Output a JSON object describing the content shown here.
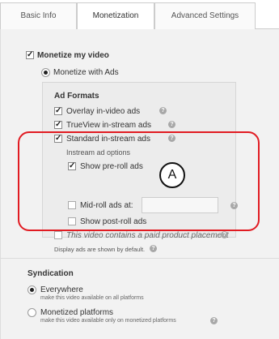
{
  "tabs": [
    {
      "label": "Basic Info"
    },
    {
      "label": "Monetization"
    },
    {
      "label": "Advanced Settings"
    }
  ],
  "monetize": {
    "label": "Monetize my video",
    "checked": true
  },
  "monetize_with_ads": {
    "label": "Monetize with Ads",
    "selected": true
  },
  "ad_formats": {
    "title": "Ad Formats",
    "overlay": {
      "label": "Overlay in-video ads",
      "checked": true
    },
    "trueview": {
      "label": "TrueView in-stream ads",
      "checked": true
    },
    "standard": {
      "label": "Standard in-stream ads",
      "checked": true
    },
    "instream_options_title": "Instream ad options",
    "preroll": {
      "label": "Show pre-roll ads",
      "checked": true
    },
    "midroll": {
      "label": "Mid-roll ads at:",
      "checked": false,
      "value": ""
    },
    "postroll": {
      "label": "Show post-roll ads",
      "checked": false
    },
    "paid_placement": {
      "label": "This video contains a paid product placement",
      "checked": false
    },
    "display_note": "Display ads are shown by default."
  },
  "annotation": {
    "letter": "A"
  },
  "syndication": {
    "title": "Syndication",
    "everywhere": {
      "label": "Everywhere",
      "desc": "make this video available on all platforms",
      "selected": true
    },
    "monetized": {
      "label": "Monetized platforms",
      "desc": "make this video available only on monetized platforms",
      "selected": false
    }
  },
  "icons": {
    "check": "✓",
    "help": "?"
  },
  "colors": {
    "annotation_ring": "#e11b22"
  }
}
